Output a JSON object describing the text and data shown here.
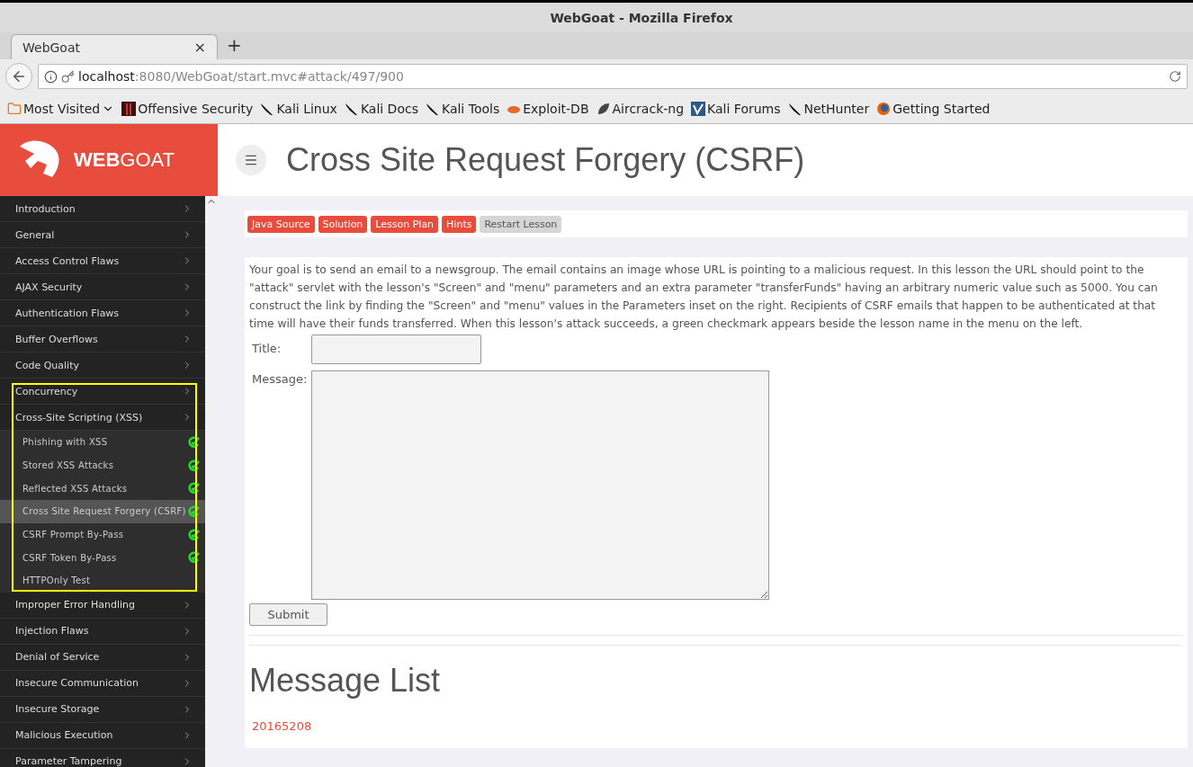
{
  "window": {
    "title": "WebGoat - Mozilla Firefox"
  },
  "tabs": [
    {
      "label": "WebGoat",
      "selected": true,
      "close": "×"
    }
  ],
  "new_tab": "+",
  "address": {
    "host": "localhost",
    "path": ":8080/WebGoat/start.mvc#attack/497/900"
  },
  "bookmarks": [
    {
      "label": "Most Visited",
      "kind": "folder"
    },
    {
      "label": "Offensive Security",
      "kind": "offsec"
    },
    {
      "label": "Kali Linux",
      "kind": "kali"
    },
    {
      "label": "Kali Docs",
      "kind": "kali"
    },
    {
      "label": "Kali Tools",
      "kind": "kali"
    },
    {
      "label": "Exploit-DB",
      "kind": "exploit"
    },
    {
      "label": "Aircrack-ng",
      "kind": "aircrack"
    },
    {
      "label": "Kali Forums",
      "kind": "forums"
    },
    {
      "label": "NetHunter",
      "kind": "kali"
    },
    {
      "label": "Getting Started",
      "kind": "firefox"
    }
  ],
  "logo": {
    "text_bold": "WEB",
    "text_light": "GOAT"
  },
  "sidebar": {
    "items": [
      {
        "label": "Introduction"
      },
      {
        "label": "General"
      },
      {
        "label": "Access Control Flaws"
      },
      {
        "label": "AJAX Security"
      },
      {
        "label": "Authentication Flaws"
      },
      {
        "label": "Buffer Overflows"
      },
      {
        "label": "Code Quality"
      },
      {
        "label": "Concurrency"
      },
      {
        "label": "Cross-Site Scripting (XSS)",
        "children": [
          {
            "label": "Phishing with XSS",
            "selected": false,
            "completed": true
          },
          {
            "label": "Stored XSS Attacks",
            "selected": false,
            "completed": true
          },
          {
            "label": "Reflected XSS Attacks",
            "selected": false,
            "completed": true
          },
          {
            "label": "Cross Site Request Forgery (CSRF)",
            "selected": true,
            "completed": true
          },
          {
            "label": "CSRF Prompt By-Pass",
            "selected": false,
            "completed": true
          },
          {
            "label": "CSRF Token By-Pass",
            "selected": false,
            "completed": true
          },
          {
            "label": "HTTPOnly Test",
            "selected": false,
            "completed": false
          }
        ]
      },
      {
        "label": "Improper Error Handling"
      },
      {
        "label": "Injection Flaws"
      },
      {
        "label": "Denial of Service"
      },
      {
        "label": "Insecure Communication"
      },
      {
        "label": "Insecure Storage"
      },
      {
        "label": "Malicious Execution"
      },
      {
        "label": "Parameter Tampering"
      }
    ]
  },
  "page_title": "Cross Site Request Forgery (CSRF)",
  "lesson_buttons": [
    {
      "label": "Java Source",
      "kind": "primary"
    },
    {
      "label": "Solution",
      "kind": "primary"
    },
    {
      "label": "Lesson Plan",
      "kind": "primary"
    },
    {
      "label": "Hints",
      "kind": "primary"
    },
    {
      "label": "Restart Lesson",
      "kind": "secondary"
    }
  ],
  "description": "Your goal is to send an email to a newsgroup. The email contains an image whose URL is pointing to a malicious request. In this lesson the URL should point to the \"attack\" servlet with the lesson's \"Screen\" and \"menu\" parameters and an extra parameter \"transferFunds\" having an arbitrary numeric value such as 5000. You can construct the link by finding the \"Screen\" and \"menu\" values in the Parameters inset on the right. Recipients of CSRF emails that happen to be authenticated at that time will have their funds transferred. When this lesson's attack succeeds, a green checkmark appears beside the lesson name in the menu on the left.",
  "form": {
    "title_label": "Title:",
    "message_label": "Message:",
    "submit": "Submit"
  },
  "message_list": {
    "heading": "Message List",
    "items": [
      "20165208"
    ]
  }
}
